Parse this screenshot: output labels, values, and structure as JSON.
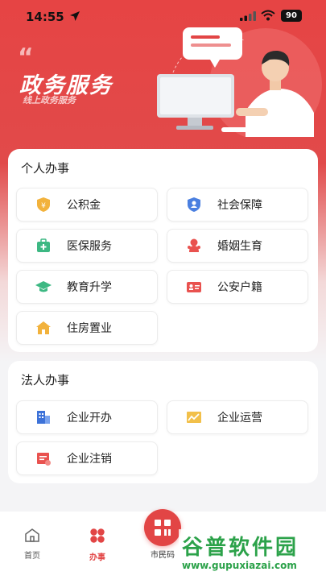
{
  "status_bar": {
    "time": "14:55",
    "battery": "90"
  },
  "hero": {
    "title": "政务服务",
    "subtitle": "线上政务服务"
  },
  "personal": {
    "title": "个人办事",
    "items": [
      {
        "label": "公积金",
        "icon": "fund-shield-icon"
      },
      {
        "label": "社会保障",
        "icon": "social-security-icon"
      },
      {
        "label": "医保服务",
        "icon": "medical-kit-icon"
      },
      {
        "label": "婚姻生育",
        "icon": "baby-icon"
      },
      {
        "label": "教育升学",
        "icon": "graduation-cap-icon"
      },
      {
        "label": "公安户籍",
        "icon": "id-card-icon"
      },
      {
        "label": "住房置业",
        "icon": "house-icon"
      }
    ]
  },
  "corporate": {
    "title": "法人办事",
    "items": [
      {
        "label": "企业开办",
        "icon": "building-icon"
      },
      {
        "label": "企业运营",
        "icon": "trend-chart-icon"
      },
      {
        "label": "企业注销",
        "icon": "cancel-doc-icon"
      }
    ]
  },
  "tabbar": {
    "home": "首页",
    "affairs": "办事",
    "citizen_code": "市民码"
  },
  "watermark": {
    "text": "谷普软件园",
    "url": "www.gupuxiazai.com"
  },
  "colors": {
    "primary": "#e24545",
    "watermark": "#2ca24a"
  }
}
